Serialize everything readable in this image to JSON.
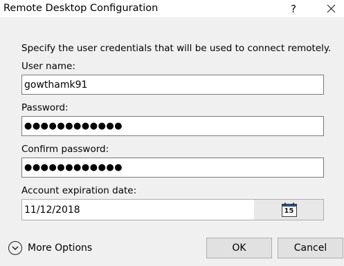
{
  "window": {
    "title": "Remote Desktop Configuration",
    "help_glyph": "?",
    "close_icon": "close-icon"
  },
  "instruction": "Specify the user credentials that will be used to connect remotely.",
  "fields": {
    "username": {
      "label": "User name:",
      "value": "gowthamk91"
    },
    "password": {
      "label": "Password:",
      "value": "●●●●●●●●●●●●"
    },
    "confirm_password": {
      "label": "Confirm password:",
      "value": "●●●●●●●●●●●●"
    },
    "expiration": {
      "label": "Account expiration date:",
      "value": "11/12/2018",
      "calendar_icon": "calendar-icon",
      "calendar_day": "15"
    }
  },
  "footer": {
    "more_options_label": "More Options",
    "more_options_icon": "chevron-down-icon",
    "ok_label": "OK",
    "cancel_label": "Cancel"
  }
}
